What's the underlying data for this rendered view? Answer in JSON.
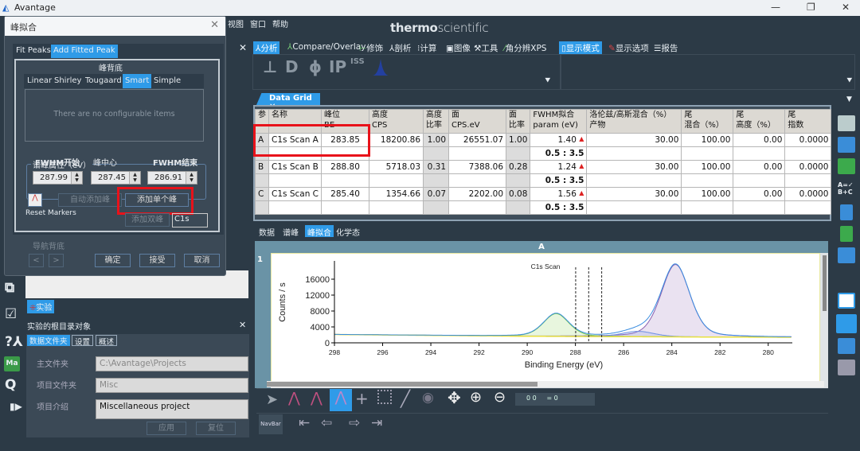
{
  "window": {
    "title": "Avantage",
    "controls": [
      "minimize",
      "restore",
      "close"
    ]
  },
  "menu": [
    "视图",
    "窗口",
    "帮助"
  ],
  "brand": {
    "thermo": "thermo",
    "scientific": "scientific"
  },
  "ribbon": {
    "tabs": [
      {
        "label": "分析",
        "active": true
      },
      {
        "label": "Compare/Overlay"
      },
      {
        "label": "修饰"
      },
      {
        "label": "剖析"
      },
      {
        "label": "计算"
      },
      {
        "label": "图像"
      },
      {
        "label": "工具"
      },
      {
        "label": "角分辨XPS"
      }
    ],
    "right_tabs": [
      {
        "label": "显示模式",
        "active": true
      },
      {
        "label": "显示选项"
      },
      {
        "label": "报告"
      }
    ],
    "tools": [
      "D",
      "ϕ",
      "IP",
      "ISS"
    ]
  },
  "data_grid": {
    "tab_label": "Data Grid",
    "headers": [
      [
        "参",
        ""
      ],
      [
        "名称",
        ""
      ],
      [
        "峰位",
        "BE"
      ],
      [
        "高度",
        "CPS"
      ],
      [
        "高度",
        "比率"
      ],
      [
        "面",
        "CPS.eV"
      ],
      [
        "面",
        "比率"
      ],
      [
        "FWHM拟合",
        "param (eV)"
      ],
      [
        "洛伦兹/高斯混合（%）",
        "产物"
      ],
      [
        "尾",
        "混合（%）"
      ],
      [
        "尾",
        "高度（%）"
      ],
      [
        "尾",
        "指数"
      ]
    ],
    "rows": [
      {
        "id": "A",
        "name": "C1s Scan A",
        "be": "283.85",
        "height": "18200.86",
        "height_ratio": "1.00",
        "area": "26551.07",
        "area_ratio": "1.00",
        "fwhm": "1.40",
        "fwhm_range": "0.5 : 3.5",
        "lg_mix": "30.00",
        "tail_mix": "100.00",
        "tail_height": "0.00",
        "tail_exp": "0.0000"
      },
      {
        "id": "B",
        "name": "C1s Scan B",
        "be": "288.80",
        "height": "5718.03",
        "height_ratio": "0.31",
        "area": "7388.06",
        "area_ratio": "0.28",
        "fwhm": "1.24",
        "fwhm_range": "0.5 : 3.5",
        "lg_mix": "30.00",
        "tail_mix": "100.00",
        "tail_height": "0.00",
        "tail_exp": "0.0000"
      },
      {
        "id": "C",
        "name": "C1s Scan C",
        "be": "285.40",
        "height": "1354.66",
        "height_ratio": "0.07",
        "area": "2202.00",
        "area_ratio": "0.08",
        "fwhm": "1.56",
        "fwhm_range": "0.5 : 3.5",
        "lg_mix": "30.00",
        "tail_mix": "100.00",
        "tail_height": "0.00",
        "tail_exp": "0.0000"
      }
    ]
  },
  "bottom_tabs": [
    {
      "label": "数据"
    },
    {
      "label": "谱峰"
    },
    {
      "label": "峰拟合",
      "active": true
    },
    {
      "label": "化学态"
    }
  ],
  "chart_panel": {
    "column": "A",
    "row": "1"
  },
  "chart_data": {
    "type": "line",
    "title": "C1s Scan",
    "xlabel": "Binding Energy (eV)",
    "ylabel": "Counts / s",
    "xlim": [
      298,
      279
    ],
    "ylim": [
      0,
      19000
    ],
    "x_reversed": true,
    "xticks": [
      298,
      296,
      294,
      292,
      290,
      288,
      286,
      284,
      282,
      280
    ],
    "yticks": [
      0,
      4000,
      8000,
      12000,
      16000
    ],
    "background": {
      "x": [
        298,
        290,
        288,
        286,
        284,
        282,
        279
      ],
      "y": [
        2100,
        1650,
        1600,
        1550,
        1500,
        1450,
        1400
      ]
    },
    "peaks": [
      {
        "name": "C1s Scan A",
        "center": 283.85,
        "height": 18200.86,
        "fwhm": 1.4,
        "color": "#8a5fb0"
      },
      {
        "name": "C1s Scan B",
        "center": 288.8,
        "height": 5718.03,
        "fwhm": 1.24,
        "color": "#7fcf4a"
      },
      {
        "name": "C1s Scan C",
        "center": 285.4,
        "height": 1354.66,
        "fwhm": 1.56,
        "color": "#6d8fe0"
      }
    ],
    "markers": [
      287.99,
      287.45,
      286.91
    ],
    "grid": false
  },
  "toolbar_bottom": {
    "readout": "0 0     = 0",
    "navbar_label": "NavBar"
  },
  "dialog": {
    "title": "峰拟合",
    "tabs": [
      {
        "label": "Fit Peaks"
      },
      {
        "label": "Add Fitted Peak",
        "active": true
      }
    ],
    "background_group": "峰背底",
    "bg_tabs": [
      {
        "label": "Linear"
      },
      {
        "label": "Shirley"
      },
      {
        "label": "Tougaard"
      },
      {
        "label": "Smart",
        "active": true
      },
      {
        "label": "Simple"
      }
    ],
    "no_items": "There are no configurable items",
    "peak_group": "谱峰属性（eV）",
    "fwhm_start_label": "FWHM开始",
    "fwhm_start": "287.99",
    "center_label": "峰中心",
    "center": "287.45",
    "fwhm_end_label": "FWHM结束",
    "fwhm_end": "286.91",
    "reset_markers": "Reset Markers",
    "auto_add": "自动添加峰",
    "add_single": "添加单个峰",
    "add_double": "添加双峰",
    "peak_name": "C1s",
    "nav_bg": "导航背底",
    "prev": "<",
    "next": ">",
    "ok": "确定",
    "accept": "接受",
    "cancel": "取消"
  },
  "experiment": {
    "tree_item": "实验",
    "panel_title": "实验的根目录对象",
    "tabs": [
      {
        "label": "数据文件夹",
        "active": true
      },
      {
        "label": "设置"
      },
      {
        "label": "概述"
      }
    ],
    "main_folder_label": "主文件夹",
    "main_folder": "C:\\Avantage\\Projects",
    "project_folder_label": "项目文件夹",
    "project_folder": "Misc",
    "project_desc_label": "项目介绍",
    "project_desc": "Miscellaneous project",
    "apply": "应用",
    "reset": "复位"
  },
  "sidebar_icons": [
    "workflow-icon",
    "checklist-icon",
    "help-person-icon",
    "ma-icon",
    "q-icon",
    "play-icon"
  ]
}
